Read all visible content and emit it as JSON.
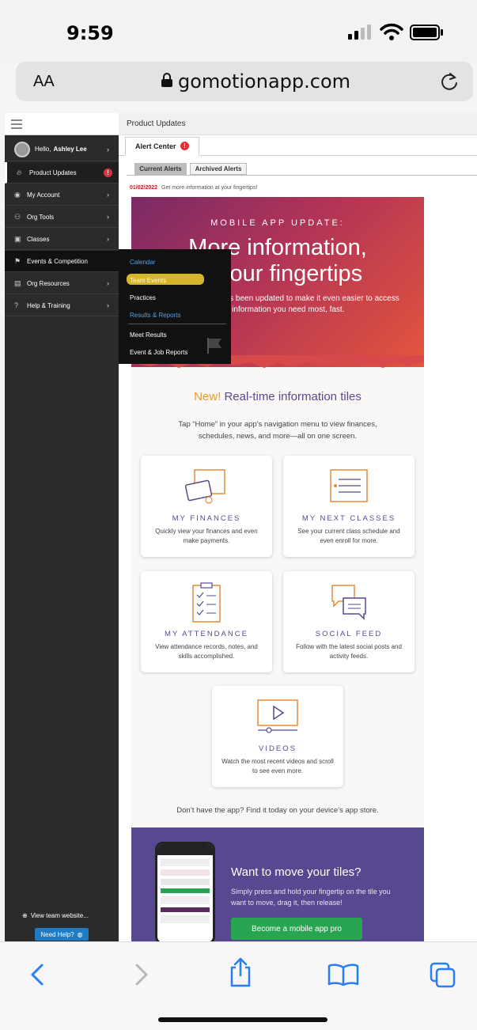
{
  "status_bar": {
    "time": "9:59"
  },
  "browser": {
    "text_size_label": "AA",
    "domain": "gomotionapp.com"
  },
  "sidebar": {
    "greeting": "Hello,",
    "user_name": "Ashley Lee",
    "items": [
      {
        "label": "Product Updates",
        "badge": "!"
      },
      {
        "label": "My Account"
      },
      {
        "label": "Org Tools"
      },
      {
        "label": "Classes"
      },
      {
        "label": "Events & Competition"
      },
      {
        "label": "Org Resources"
      },
      {
        "label": "Help & Training"
      }
    ],
    "view_website": "View team website...",
    "need_help": "Need Help?"
  },
  "main": {
    "breadcrumb": "Product Updates",
    "tab": "Alert Center",
    "tab_badge": "!",
    "subtabs": [
      "Current Alerts",
      "Archived Alerts"
    ],
    "alert_date": "01/02/2022",
    "alert_text": "Get more information at your fingertips!"
  },
  "flyout": {
    "items": [
      "Calendar",
      "Team Events",
      "Practices",
      "Results & Reports",
      "Meet Results",
      "Event & Job Reports"
    ]
  },
  "newsletter": {
    "kicker": "MOBILE APP UPDATE:",
    "title_line1": "More information,",
    "title_line2": "at your fingertips",
    "body": "The mobile app has been updated to make it even easier to access the information you need most, fast.",
    "tiles_new": "New!",
    "tiles_heading": "Real-time information tiles",
    "tiles_intro": "Tap “Home” in your app’s navigation menu to view finances, schedules, news, and more—all on one screen.",
    "tiles": [
      {
        "title": "MY FINANCES",
        "desc": "Quickly view your finances and even make payments."
      },
      {
        "title": "MY NEXT CLASSES",
        "desc": "See your current class schedule and even enroll for more."
      },
      {
        "title": "MY ATTENDANCE",
        "desc": "View attendance records, notes, and skills accomplished."
      },
      {
        "title": "SOCIAL FEED",
        "desc": "Follow with the latest social posts and activity feeds."
      },
      {
        "title": "VIDEOS",
        "desc": "Watch the most recent videos and scroll to see even more."
      }
    ],
    "apps_line": "Don’t have the app? Find it today on your device’s app store.",
    "promo_title": "Want to move your tiles?",
    "promo_body": "Simply press and hold your fingertip on the tile you want to move, drag it, then release!",
    "promo_button": "Become a mobile app pro"
  },
  "colors": {
    "accent_purple": "#5a4891",
    "alert_red": "#e0323c",
    "promo_green": "#27a550",
    "safari_blue": "#2a7ef5"
  }
}
